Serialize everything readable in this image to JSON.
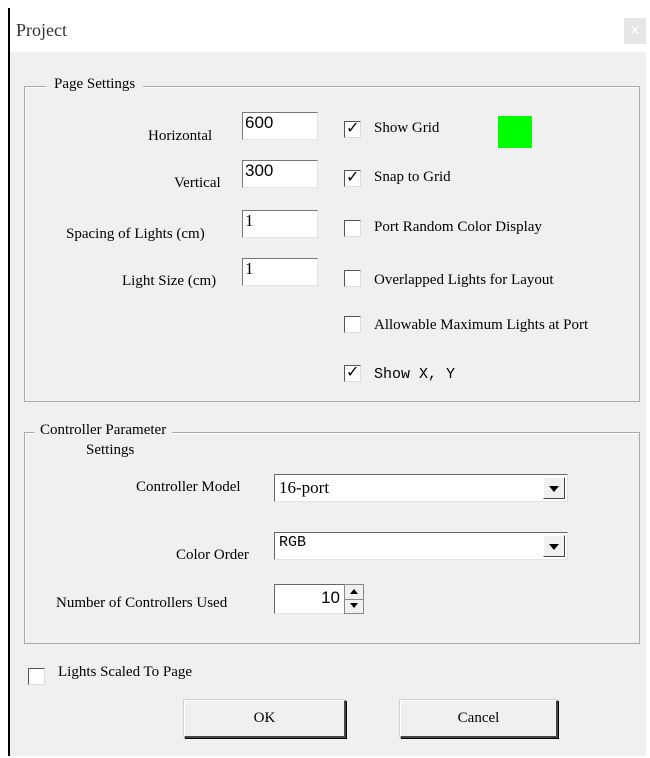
{
  "window": {
    "title": "Project"
  },
  "page_settings": {
    "legend": "Page Settings",
    "horizontal_label": "Horizontal",
    "horizontal_value": "600",
    "vertical_label": "Vertical",
    "vertical_value": "300",
    "spacing_label": "Spacing of Lights (cm)",
    "spacing_value": "1",
    "light_size_label": "Light Size (cm)",
    "light_size_value": "1",
    "show_grid_label": "Show Grid",
    "show_grid_checked": true,
    "grid_color": "#00ff00",
    "snap_label": "Snap to Grid",
    "snap_checked": true,
    "port_random_label": "Port Random Color Display",
    "port_random_checked": false,
    "overlapped_label": "Overlapped Lights for Layout",
    "overlapped_checked": false,
    "allowable_label": "Allowable Maximum Lights at Port",
    "allowable_checked": false,
    "show_xy_label": "Show X, Y",
    "show_xy_checked": true
  },
  "controller": {
    "legend_line1": "Controller Parameter",
    "legend_line2": "Settings",
    "model_label": "Controller Model",
    "model_value": "16-port",
    "color_order_label": "Color Order",
    "color_order_value": "RGB",
    "count_label": "Number of Controllers Used",
    "count_value": "10"
  },
  "lights_scaled": {
    "label": "Lights Scaled To Page",
    "checked": false
  },
  "buttons": {
    "ok": "OK",
    "cancel": "Cancel"
  },
  "colors": {
    "dialog_bg": "#f0f0f0",
    "titlebar_bg": "#ffffff"
  }
}
